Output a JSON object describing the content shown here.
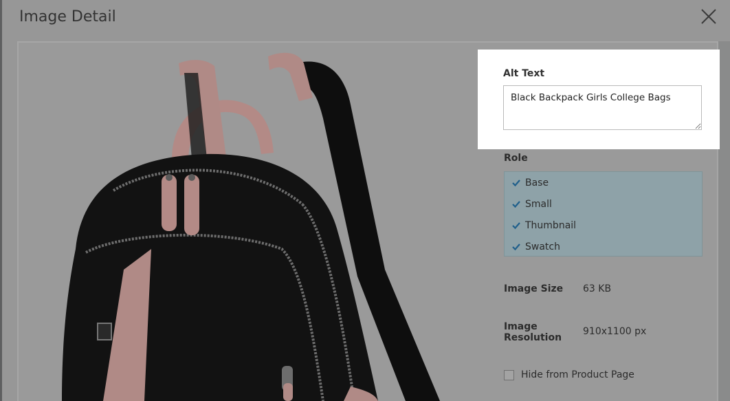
{
  "modal": {
    "title": "Image Detail",
    "close_icon": "close-icon"
  },
  "image": {
    "subject": "black backpack with pink leather straps"
  },
  "alt_text": {
    "label": "Alt Text",
    "value": "Black Backpack Girls College Bags"
  },
  "role": {
    "label": "Role",
    "items": [
      {
        "label": "Base",
        "checked": true
      },
      {
        "label": "Small",
        "checked": true
      },
      {
        "label": "Thumbnail",
        "checked": true
      },
      {
        "label": "Swatch",
        "checked": true
      }
    ]
  },
  "info": {
    "size_label": "Image Size",
    "size_value": "63 KB",
    "resolution_label_line1": "Image",
    "resolution_label_line2": "Resolution",
    "resolution_value": "910x1100 px"
  },
  "hide": {
    "label": "Hide from Product Page",
    "checked": false
  },
  "colors": {
    "overlay": "#979797",
    "highlight": "#ffffff",
    "role_bg": "#8ea2a8",
    "check": "#1f5f8b"
  }
}
